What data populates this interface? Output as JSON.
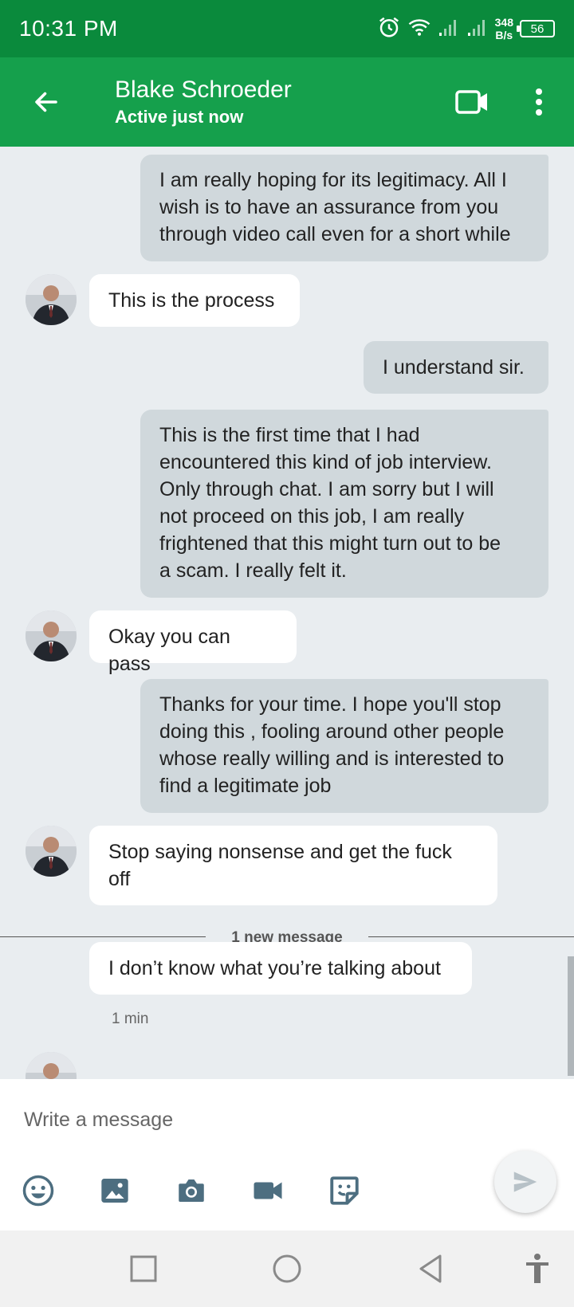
{
  "status_bar": {
    "time": "10:31 PM",
    "net_speed": "348",
    "net_unit": "B/s",
    "battery": "56"
  },
  "header": {
    "contact_name": "Blake Schroeder",
    "contact_status": "Active just now"
  },
  "messages": [
    {
      "direction": "out",
      "text": "I am really hoping for its legitimacy. All I\n wish is to have an assurance from you\nthrough video call even for a short while"
    },
    {
      "direction": "in",
      "text": "This is the process"
    },
    {
      "direction": "out",
      "text": "I understand sir."
    },
    {
      "direction": "out",
      "text": "This is the first time that I had\nencountered this kind of job interview.\nOnly through chat. I am sorry but I will\nnot proceed on this job, I am really\nfrightened that this might turn out to be\na scam. I really felt it."
    },
    {
      "direction": "in",
      "text": "Okay you can pass"
    },
    {
      "direction": "out",
      "text": "Thanks for your time. I hope you'll stop\ndoing this , fooling around other people\nwhose really willing and is interested to\nfind a legitimate job"
    },
    {
      "direction": "in",
      "text": "Stop saying nonsense and get the fuck\noff"
    },
    {
      "direction": "in",
      "text": "I don’t know what you’re talking about"
    }
  ],
  "new_message_divider": "1 new message",
  "last_message_time": "1 min",
  "composer": {
    "placeholder": "Write a message"
  },
  "colors": {
    "status_bar": "#0a8a3c",
    "app_bar": "#15a04c",
    "outgoing_bubble": "#d0d8dc",
    "incoming_bubble": "#ffffff",
    "background": "#e9edf0"
  },
  "icons": [
    "back-arrow-icon",
    "video-call-icon",
    "more-vert-icon",
    "emoji-icon",
    "image-icon",
    "camera-icon",
    "video-icon",
    "sticker-icon",
    "send-icon"
  ]
}
